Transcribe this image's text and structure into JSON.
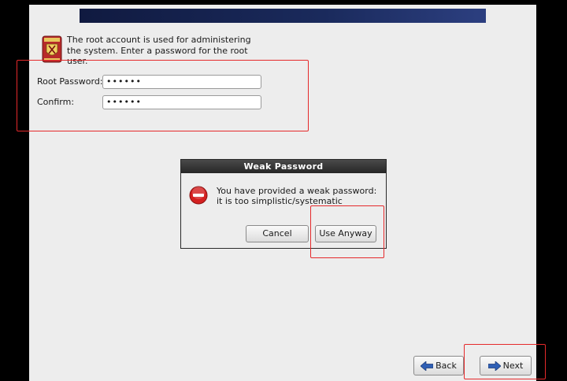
{
  "root_account": {
    "description": "The root account is used for administering the system.  Enter a password for the root user.",
    "root_password_label": "Root Password:",
    "root_password_value": "••••••",
    "confirm_label": "Confirm:",
    "confirm_value": "••••••"
  },
  "dialog": {
    "title": "Weak Password",
    "message": "You have provided a weak password: it is too simplistic/systematic",
    "cancel_label": "Cancel",
    "use_anyway_label": "Use Anyway"
  },
  "navigation": {
    "back_label": "Back",
    "next_label": "Next"
  },
  "colors": {
    "highlight": "#e5292b",
    "banner": "#1a2a5c",
    "error_icon": "#d42020",
    "arrow_icon": "#2f5fb5"
  },
  "icons": {
    "root": "root-shield-icon",
    "error": "error-icon",
    "back": "back-arrow-icon",
    "next": "next-arrow-icon"
  }
}
